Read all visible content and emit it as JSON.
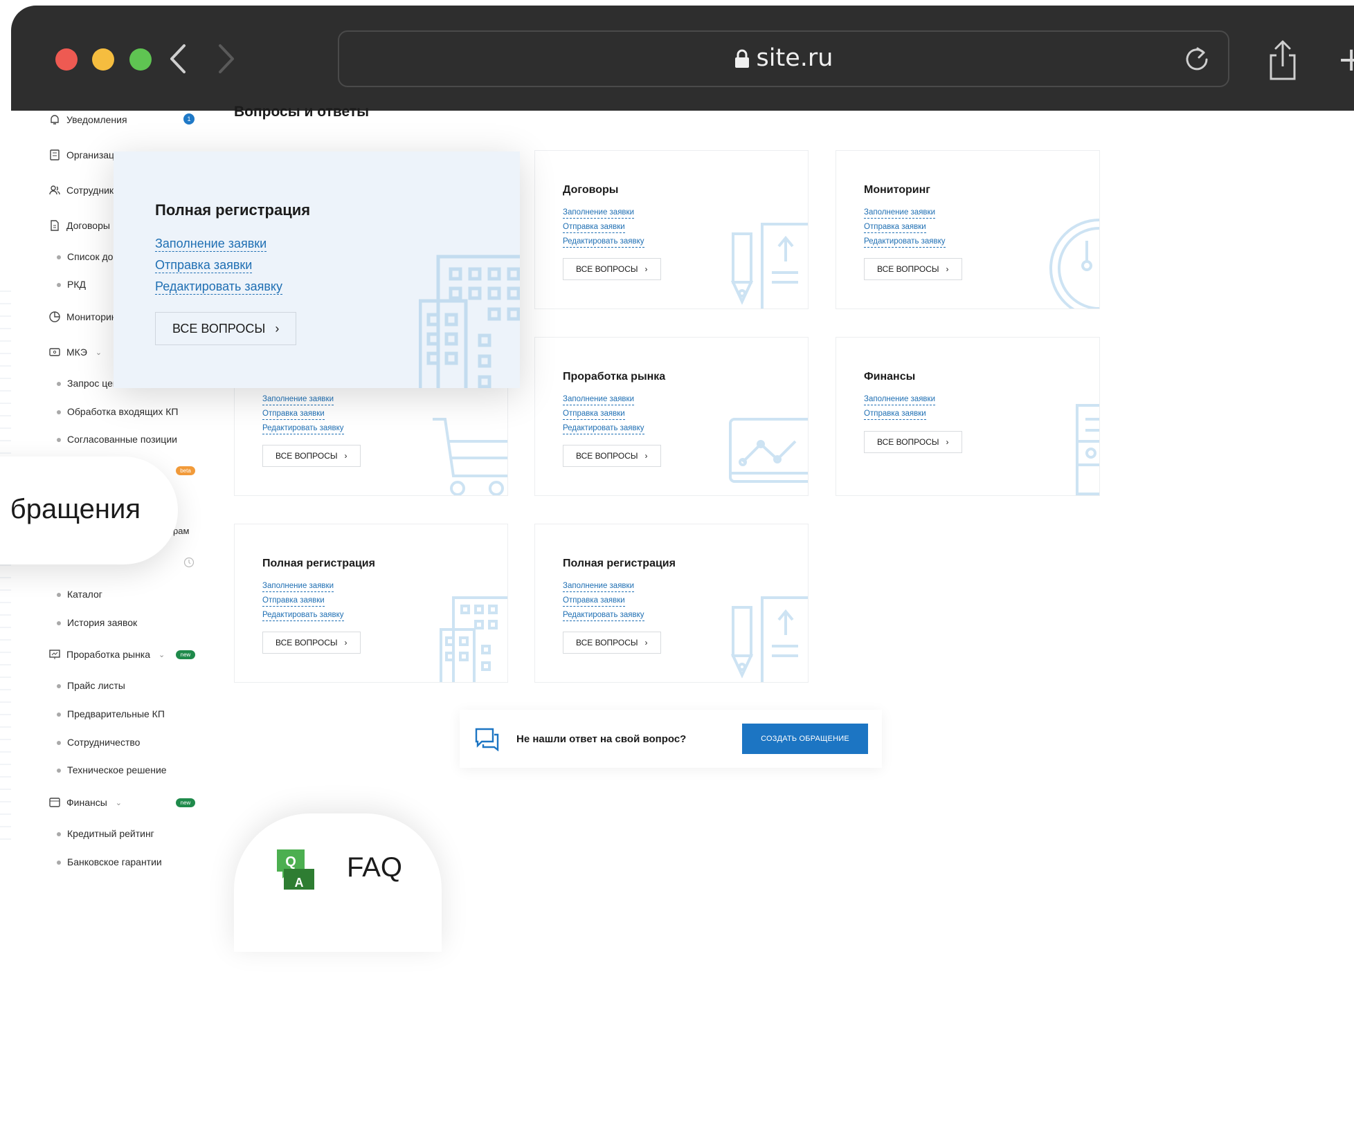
{
  "browser": {
    "url": "site.ru",
    "plus_glyph": "+"
  },
  "sidebar": {
    "notifications": {
      "label": "Уведомления",
      "count": "1"
    },
    "items": [
      {
        "label": "Организация"
      },
      {
        "label": "Сотрудники"
      },
      {
        "label": "Договоры"
      },
      {
        "label": "Мониторинг"
      },
      {
        "label": "МКЭ"
      },
      {
        "label": "Проработка рынка",
        "badge": "new"
      },
      {
        "label": "Финансы",
        "badge": "new"
      }
    ],
    "sub_contracts": [
      "Список дого",
      "РКД"
    ],
    "sub_mke": [
      "Запрос цены",
      "Обработка входящих КП",
      "Согласованные позиции"
    ],
    "beta_badge": "beta",
    "partial_label": "рам",
    "sub_catalog": [
      "Каталог",
      "История заявок"
    ],
    "sub_market": [
      "Прайс листы",
      "Предварительные КП",
      "Сотрудничество",
      "Техническое решение"
    ],
    "sub_finance": [
      "Кредитный рейтинг",
      "Банковское гарантии"
    ]
  },
  "page": {
    "title": "Вопросы и ответы"
  },
  "cards": [
    {
      "title": "Договоры",
      "links": [
        "Заполнение заявки",
        "Отправка заявки",
        "Редактировать заявку"
      ],
      "button": "ВСЕ ВОПРОСЫ"
    },
    {
      "title": "Мониторинг",
      "links": [
        "Заполнение заявки",
        "Отправка заявки",
        "Редактировать заявку"
      ],
      "button": "ВСЕ ВОПРОСЫ"
    },
    {
      "links": [
        "Заполнение заявки",
        "Отправка заявки",
        "Редактировать заявку"
      ],
      "button": "ВСЕ ВОПРОСЫ"
    },
    {
      "title": "Проработка рынка",
      "links": [
        "Заполнение заявки",
        "Отправка заявки",
        "Редактировать заявку"
      ],
      "button": "ВСЕ ВОПРОСЫ"
    },
    {
      "title": "Финансы",
      "links": [
        "Заполнение заявки",
        "Отправка заявки"
      ],
      "button": "ВСЕ ВОПРОСЫ"
    },
    {
      "title": "Полная регистрация",
      "links": [
        "Заполнение заявки",
        "Отправка заявки",
        "Редактировать заявку"
      ],
      "button": "ВСЕ ВОПРОСЫ"
    },
    {
      "title": "Полная регистрация",
      "links": [
        "Заполнение заявки",
        "Отправка заявки",
        "Редактировать заявку"
      ],
      "button": "ВСЕ ВОПРОСЫ"
    }
  ],
  "popup_card": {
    "title": "Полная регистрация",
    "links": [
      "Заполнение заявки",
      "Отправка заявки",
      "Редактировать заявку"
    ],
    "button": "ВСЕ ВОПРОСЫ"
  },
  "help": {
    "question": "Не нашли ответ на свой вопрос?",
    "cta": "СОЗДАТЬ ОБРАЩЕНИЕ"
  },
  "floating": {
    "appeals_label": "бращения",
    "faq_label": "FAQ",
    "faq_q": "Q",
    "faq_a": "A"
  },
  "colors": {
    "accent": "#1c75c3",
    "link": "#1f6fb3",
    "new_badge": "#1f8a4b",
    "beta_badge": "#f29b3a",
    "toolbar": "#2e2e2e"
  }
}
